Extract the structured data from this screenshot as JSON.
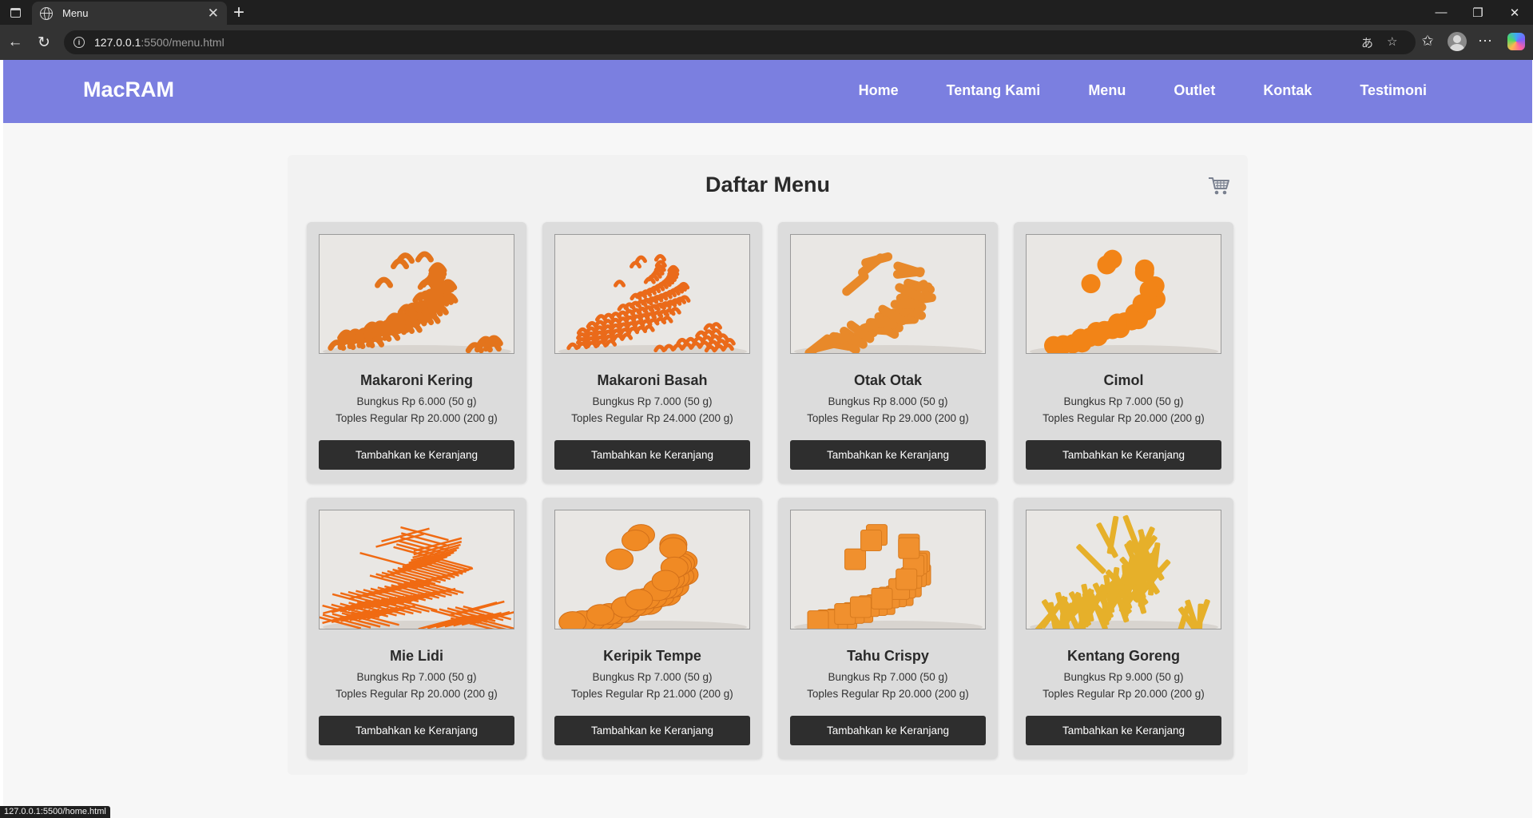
{
  "browser": {
    "tab_title": "Menu",
    "url_host": "127.0.0.1",
    "url_rest": ":5500/menu.html",
    "status_url": "127.0.0.1:5500/home.html"
  },
  "site": {
    "brand": "MacRAM",
    "nav": [
      "Home",
      "Tentang Kami",
      "Menu",
      "Outlet",
      "Kontak",
      "Testimoni"
    ]
  },
  "menu": {
    "title": "Daftar Menu",
    "button_label": "Tambahkan ke Keranjang",
    "items": [
      {
        "name": "Makaroni Kering",
        "price_pack": "Bungkus Rp 6.000 (50 g)",
        "price_jar": "Toples Regular Rp 20.000 (200 g)",
        "image": "macaroni-dry"
      },
      {
        "name": "Makaroni Basah",
        "price_pack": "Bungkus Rp 7.000 (50 g)",
        "price_jar": "Toples Regular Rp 24.000 (200 g)",
        "image": "macaroni-wet"
      },
      {
        "name": "Otak Otak",
        "price_pack": "Bungkus Rp 8.000 (50 g)",
        "price_jar": "Toples Regular Rp 29.000 (200 g)",
        "image": "otak-otak"
      },
      {
        "name": "Cimol",
        "price_pack": "Bungkus Rp 7.000 (50 g)",
        "price_jar": "Toples Regular Rp 20.000 (200 g)",
        "image": "cimol"
      },
      {
        "name": "Mie Lidi",
        "price_pack": "Bungkus Rp 7.000 (50 g)",
        "price_jar": "Toples Regular Rp 20.000 (200 g)",
        "image": "mie-lidi"
      },
      {
        "name": "Keripik Tempe",
        "price_pack": "Bungkus Rp 7.000 (50 g)",
        "price_jar": "Toples Regular Rp 21.000 (200 g)",
        "image": "tempe-chips"
      },
      {
        "name": "Tahu Crispy",
        "price_pack": "Bungkus Rp 7.000 (50 g)",
        "price_jar": "Toples Regular Rp 20.000 (200 g)",
        "image": "tofu-cubes"
      },
      {
        "name": "Kentang Goreng",
        "price_pack": "Bungkus Rp 9.000 (50 g)",
        "price_jar": "Toples Regular Rp 20.000 (200 g)",
        "image": "fries"
      }
    ]
  },
  "colors": {
    "header": "#7b7fe0",
    "button": "#2e2e2e",
    "card": "#dcdcdc",
    "snack_orange": "#f07a1a",
    "fries_yellow": "#e6b02a"
  }
}
